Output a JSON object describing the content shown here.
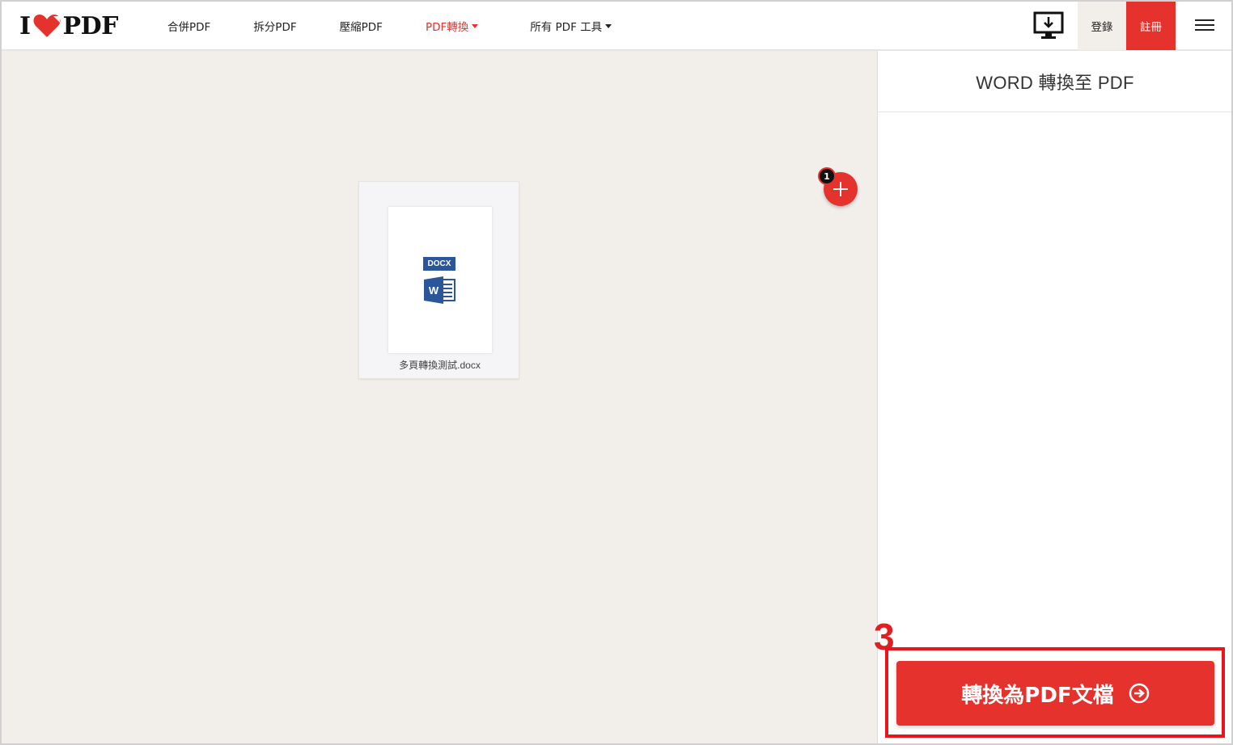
{
  "header": {
    "logo_left": "I",
    "logo_right": "PDF",
    "nav": [
      {
        "label": "合併PDF"
      },
      {
        "label": "拆分PDF"
      },
      {
        "label": "壓縮PDF"
      },
      {
        "label": "PDF轉換"
      },
      {
        "label": "所有 PDF 工具"
      }
    ],
    "login_label": "登錄",
    "signup_label": "註冊"
  },
  "workspace": {
    "file": {
      "type_badge": "DOCX",
      "word_letter": "W",
      "name": "多頁轉換測試.docx"
    },
    "file_count": "1"
  },
  "sidebar": {
    "title": "WORD 轉換至 PDF",
    "step_label": "3",
    "convert_label": "轉換為PDF文檔"
  },
  "colors": {
    "brand": "#e5322d",
    "word_blue": "#2b579a",
    "workspace_bg": "#f2efeb"
  }
}
